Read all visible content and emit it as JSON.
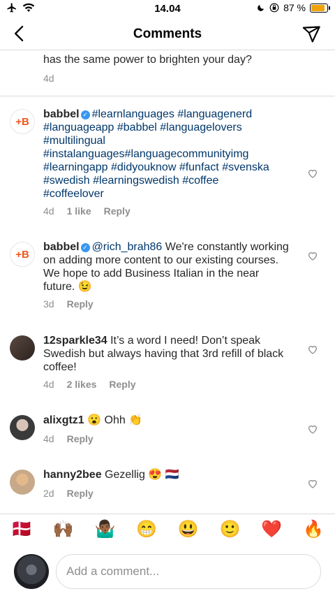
{
  "status_bar": {
    "time": "14.04",
    "battery_text": "87 %",
    "battery_level": 0.87
  },
  "header": {
    "title": "Comments"
  },
  "top_comment": {
    "text_fragment": "has the same power to brighten your day?",
    "age": "4d"
  },
  "comments": [
    {
      "username": "babbel",
      "verified": true,
      "text": "#learnlanguages #languagenerd #languageapp #babbel #languagelovers #multilingual #instalanguages#languagecommunityimg #learningapp #didyouknow #funfact #svenska #swedish #learningswedish #coffee #coffeelover",
      "age": "4d",
      "likes": "1 like",
      "reply": "Reply"
    },
    {
      "username": "babbel",
      "verified": true,
      "mention": "@rich_brah86",
      "text": "We're constantly working on adding more content to our existing courses. We hope to add Business Italian in the near future. 😉",
      "age": "3d",
      "reply": "Reply"
    },
    {
      "username": "12sparkle34",
      "text": "It’s a word I need! Don’t speak Swedish but always having that 3rd refill of black coffee!",
      "age": "4d",
      "likes": "2 likes",
      "reply": "Reply"
    },
    {
      "username": "alixgtz1",
      "text": "😮 Ohh 👏",
      "age": "4d",
      "reply": "Reply"
    },
    {
      "username": "hanny2bee",
      "text": "Gezellig 😍 🇳🇱",
      "age": "2d",
      "reply": "Reply"
    }
  ],
  "babbel_avatar_text": "+B",
  "hashtags_lines": [
    "#learnlanguages #languagenerd",
    "#languageapp #babbel #languagelovers",
    "#multilingual",
    "#instalanguages#languagecommunityimg",
    "#learningapp #didyouknow #funfact #svenska",
    "#swedish #learningswedish #coffee",
    "#coffeelover"
  ],
  "emoji_bar": [
    "🇩🇰",
    "🙌🏾",
    "🤷🏾‍♂️",
    "😁",
    "😃",
    "🙂",
    "❤️",
    "🔥"
  ],
  "composer": {
    "placeholder": "Add a comment..."
  }
}
